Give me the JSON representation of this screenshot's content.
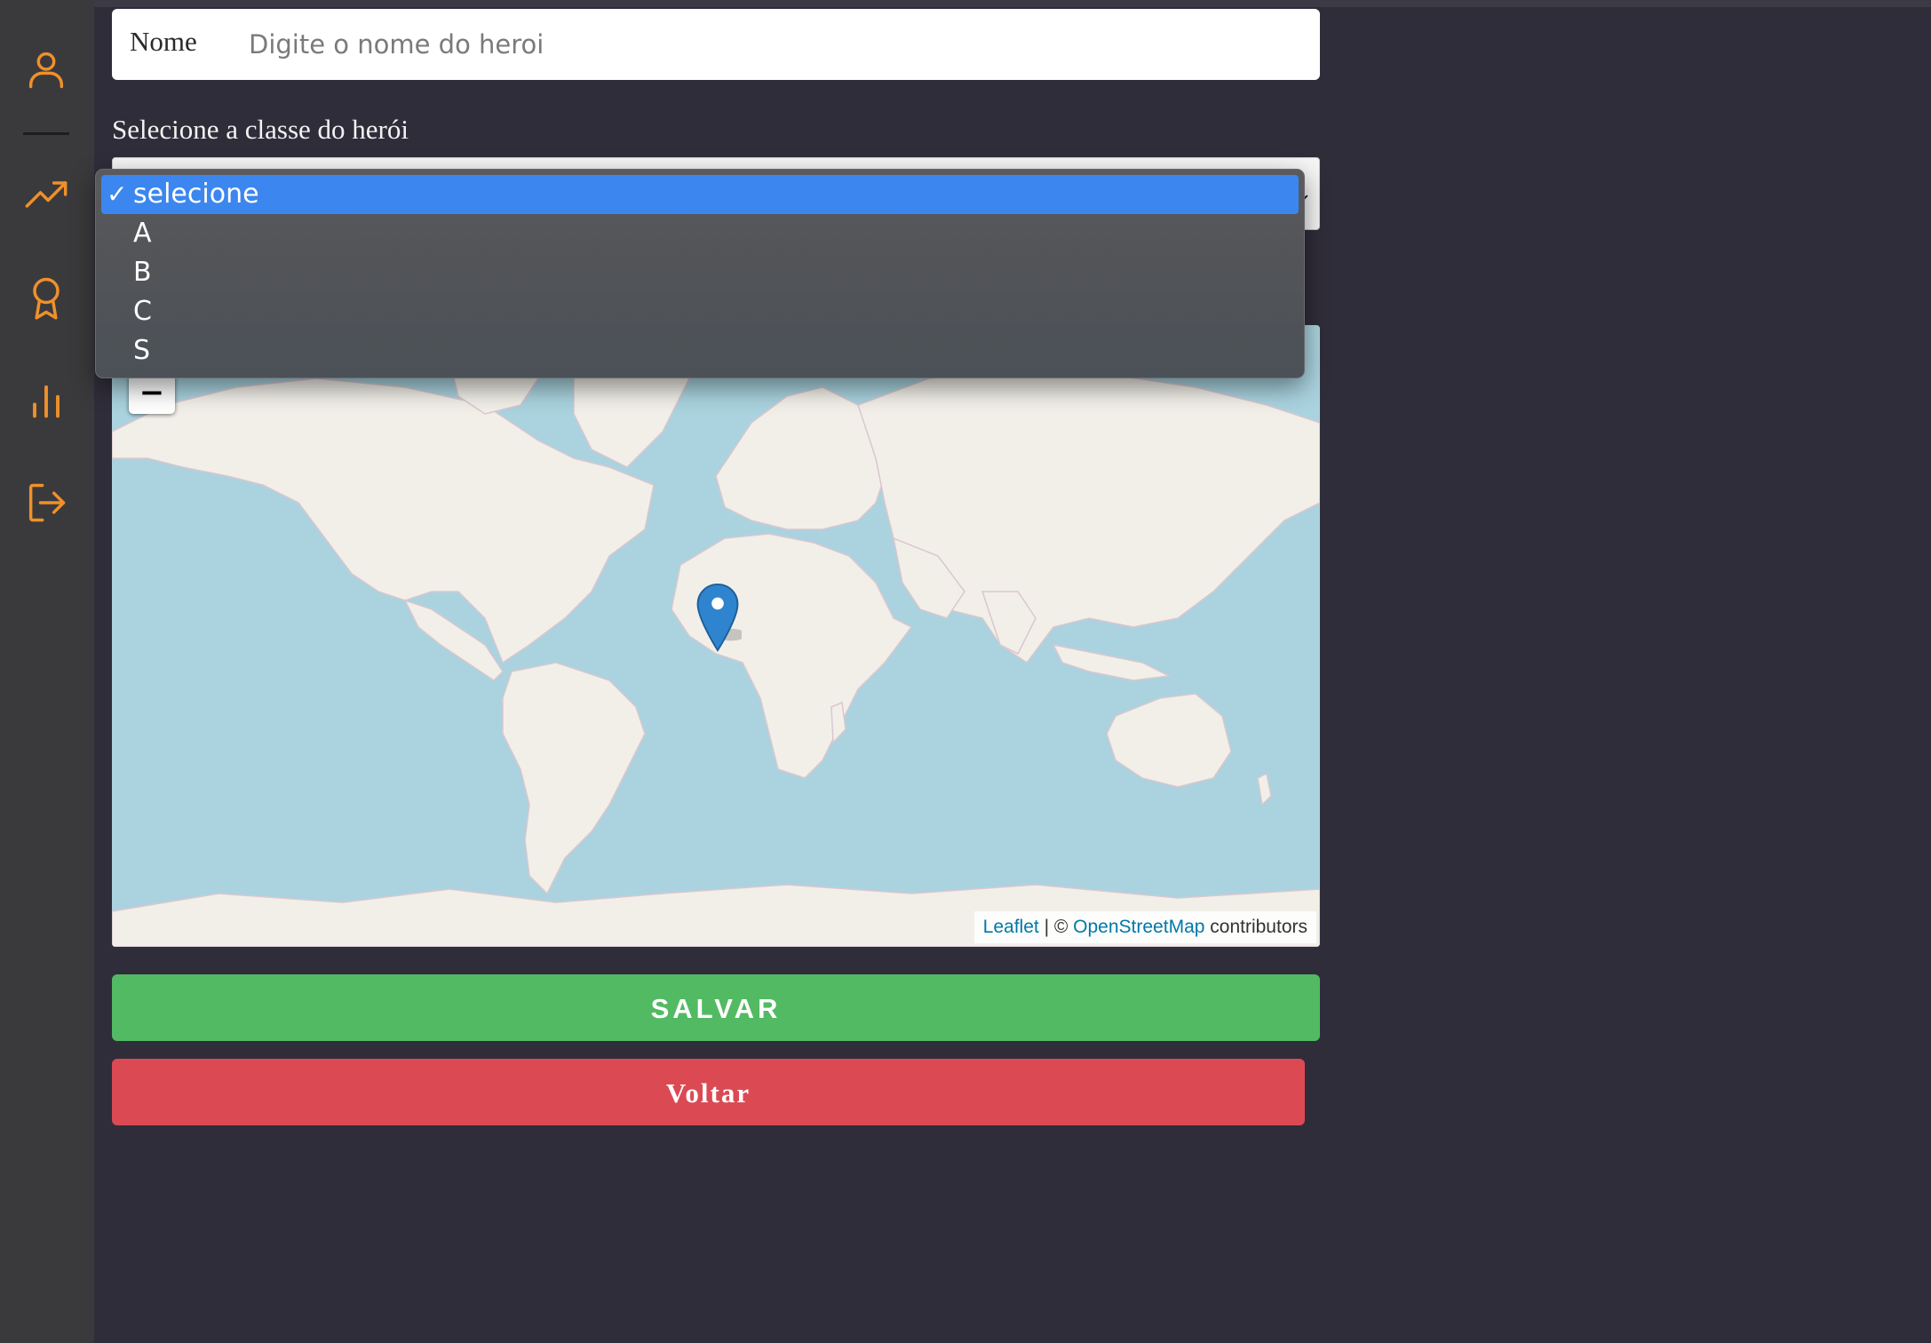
{
  "sidebar": {
    "items": [
      {
        "icon": "user-icon"
      },
      {
        "icon": "trending-up-icon"
      },
      {
        "icon": "award-icon"
      },
      {
        "icon": "bar-chart-icon"
      },
      {
        "icon": "logout-icon"
      }
    ],
    "accent_color": "#f0902a"
  },
  "form": {
    "name_label": "Nome",
    "name_placeholder": "Digite o nome do heroi",
    "name_value": "",
    "class_label": "Selecione a classe do herói",
    "class_selected": "selecione"
  },
  "dropdown": {
    "options": [
      {
        "label": "selecione",
        "selected": true,
        "check": "✓"
      },
      {
        "label": "A",
        "selected": false
      },
      {
        "label": "B",
        "selected": false
      },
      {
        "label": "C",
        "selected": false
      },
      {
        "label": "S",
        "selected": false
      }
    ]
  },
  "map": {
    "zoom_in": "+",
    "zoom_out": "−",
    "attribution": {
      "leaflet": "Leaflet",
      "separator": " | © ",
      "osm": "OpenStreetMap",
      "suffix": " contributors"
    },
    "marker_icon": "map-pin-icon"
  },
  "actions": {
    "save_label": "SALVAR",
    "back_label": "Voltar",
    "save_color": "#52ba63",
    "back_color": "#db4a53"
  }
}
